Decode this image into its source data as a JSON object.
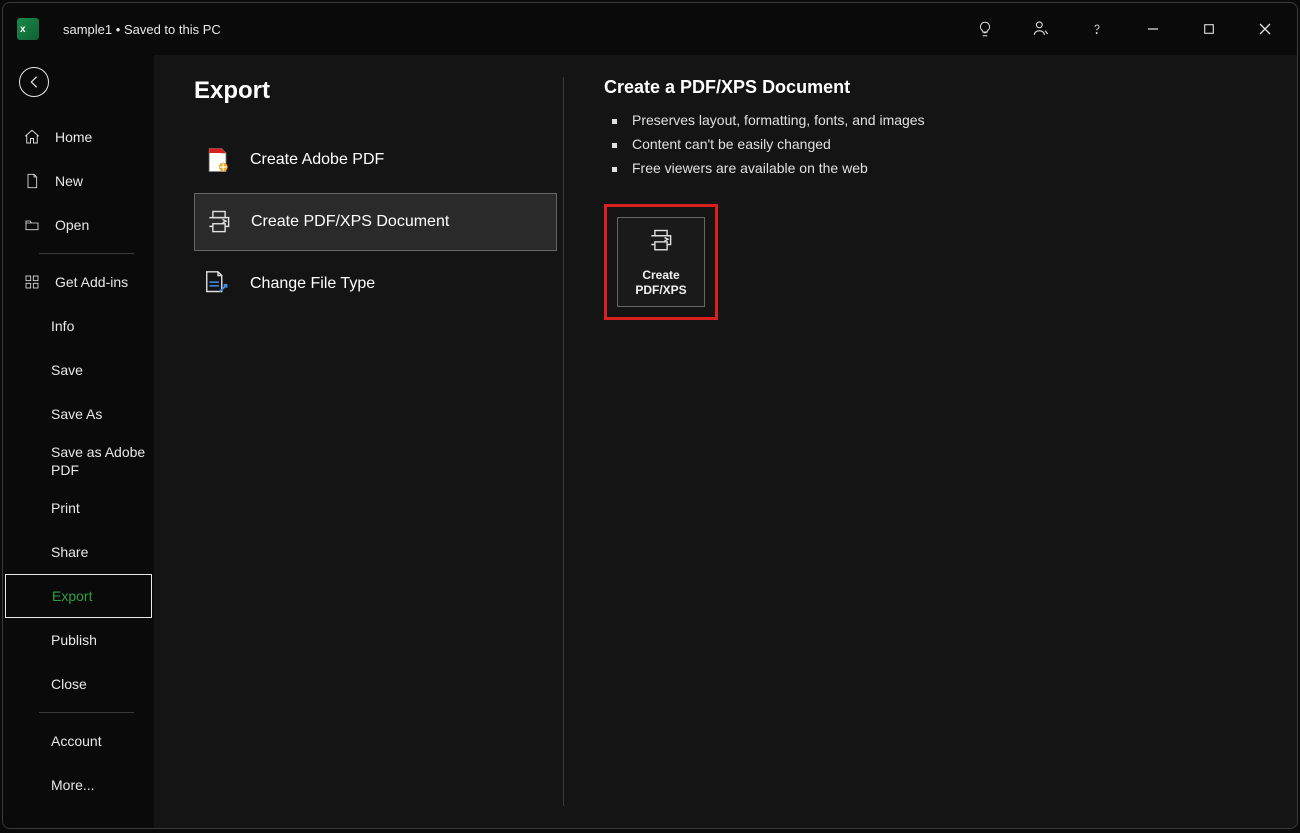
{
  "title": {
    "filename": "sample1",
    "status": "Saved to this PC"
  },
  "sidebar": {
    "items": [
      {
        "label": "Home",
        "icon": "home"
      },
      {
        "label": "New",
        "icon": "document"
      },
      {
        "label": "Open",
        "icon": "folder"
      }
    ],
    "addins": {
      "label": "Get Add-ins",
      "icon": "grid"
    },
    "secondary": [
      {
        "label": "Info"
      },
      {
        "label": "Save"
      },
      {
        "label": "Save As"
      },
      {
        "label": "Save as Adobe PDF"
      },
      {
        "label": "Print"
      },
      {
        "label": "Share"
      },
      {
        "label": "Export",
        "selected": true
      },
      {
        "label": "Publish"
      },
      {
        "label": "Close"
      }
    ],
    "footer": [
      {
        "label": "Account"
      },
      {
        "label": "More..."
      }
    ]
  },
  "main": {
    "title": "Export",
    "options": [
      {
        "label": "Create Adobe PDF",
        "icon": "pdf-adobe"
      },
      {
        "label": "Create PDF/XPS Document",
        "icon": "printer",
        "selected": true
      },
      {
        "label": "Change File Type",
        "icon": "change-type"
      }
    ],
    "detail": {
      "heading": "Create a PDF/XPS Document",
      "bullets": [
        "Preserves layout, formatting, fonts, and images",
        "Content can't be easily changed",
        "Free viewers are available on the web"
      ],
      "action_label_line1": "Create",
      "action_label_line2": "PDF/XPS"
    }
  }
}
